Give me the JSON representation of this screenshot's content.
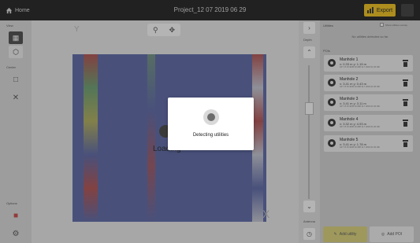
{
  "topbar": {
    "home_label": "Home",
    "title": "Project_12 07 2019 06 29",
    "export_label": "Export"
  },
  "left_panel": {
    "view_label": "View",
    "center_label": "Center",
    "options_label": "Options"
  },
  "main": {
    "y_axis_letter": "Y",
    "x_axis_letter": "X",
    "loading_text": "Loading"
  },
  "rail": {
    "depth_label": "Depth",
    "antenna_label": "Antenna"
  },
  "utilities": {
    "header": "Utilities",
    "toggle_label": "Show utilities overlay",
    "empty_text": "No utilities detected so far",
    "pois_header": "POIs"
  },
  "pois": [
    {
      "name": "Manhole 1",
      "coords": "x: 0.33 m  y: 1.15 m",
      "meta": "GP 7.8 15.3045 16.098  11.7  2019 01 06 19h"
    },
    {
      "name": "Manhole 2",
      "coords": "x: 3.41 m  y: 0.43 m",
      "meta": "GP 7.8 15.3045 16.098  11.7  2019 01 06 19h"
    },
    {
      "name": "Manhole 3",
      "coords": "x: 3.41 m  y: 3.11 m",
      "meta": "GP 7.8 15.3045 16.098  11.7  2019 01 06 19h"
    },
    {
      "name": "Manhole 4",
      "coords": "x: 3.32 m  y: 4.93 m",
      "meta": "GP 7.8 15.3045 16.098  11.7  2019 01 06 19h"
    },
    {
      "name": "Manhole 5",
      "coords": "x: 3.41 m  y: 1.78 m",
      "meta": "GP 7.8 15.3045 16.098  11.7  2019 01 06 19h"
    }
  ],
  "bottom_buttons": {
    "add_utility": "Add utility",
    "add_poi": "Add POI"
  },
  "modal": {
    "message": "Detecting utilities"
  },
  "colors": {
    "topbar": "#1e1e1e",
    "accent": "#f3c41a",
    "plot": "#5b67a8"
  }
}
